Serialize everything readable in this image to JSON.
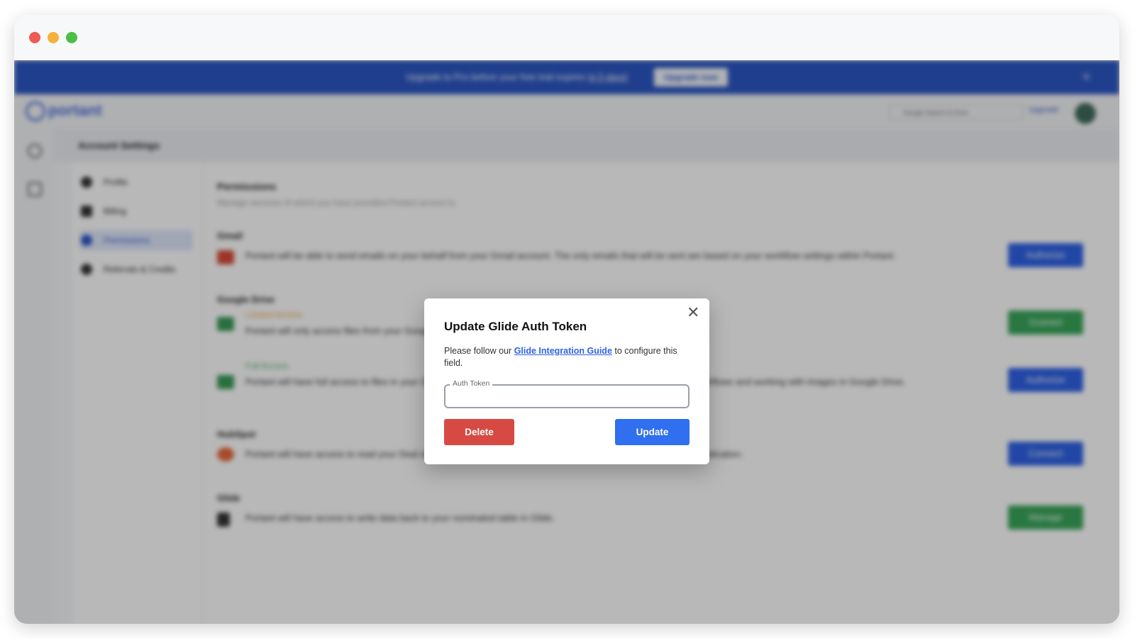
{
  "banner": {
    "message": "Upgrade to Pro before your free trial expires",
    "days_link": "in 5 days!",
    "button_label": "Upgrade now",
    "close_glyph": "✕"
  },
  "topbar": {
    "logo_text": "portant",
    "search_placeholder": "Google Search & Drive",
    "upgrade_label": "Upgrade"
  },
  "subheader": {
    "title": "Account Settings"
  },
  "nav": {
    "items": [
      {
        "label": "Profile",
        "icon": "person-icon"
      },
      {
        "label": "Billing",
        "icon": "card-icon"
      },
      {
        "label": "Permissions",
        "icon": "shield-icon",
        "active": true
      },
      {
        "label": "Referrals & Credits",
        "icon": "gift-icon"
      }
    ]
  },
  "permissions": {
    "title": "Permissions",
    "subtitle": "Manage services of which you have provided Portant access to",
    "gmail": {
      "heading": "Gmail",
      "description": "Portant will be able to send emails on your behalf from your Gmail account. The only emails that will be sent are based on your workflow settings within Portant.",
      "button": "Authorize"
    },
    "drive": {
      "heading": "Google Drive",
      "limited_badge": "Limited Access",
      "limited_description": "Portant will only access files from your Google Drive which have been created by or explicitly shared with Portant.",
      "limited_button": "Granted",
      "full_badge": "Full Access",
      "full_description": "Portant will have full access to files in your Google Drive. This is useful for advanced features such as shared workflows and working with images in Google Drive.",
      "full_button": "Authorize"
    },
    "hubspot": {
      "heading": "HubSpot",
      "description": "Portant will have access to read your Deal objects. This allows you to run workflows from the Portant HubSpot application.",
      "button": "Connect"
    },
    "glide": {
      "heading": "Glide",
      "description": "Portant will have access to write data back to your nominated table in Glide.",
      "button": "Manage"
    }
  },
  "modal": {
    "title": "Update Glide Auth Token",
    "text_before": "Please follow our",
    "link_text": "Glide Integration Guide",
    "text_after": "to configure this field.",
    "field_label": "Auth Token",
    "field_value": "",
    "delete_label": "Delete",
    "update_label": "Update",
    "close_glyph": "✕"
  },
  "colors": {
    "banner": "#2c57c4",
    "primary": "#2f6ff0",
    "danger": "#d64a43",
    "success": "#39a65a"
  }
}
